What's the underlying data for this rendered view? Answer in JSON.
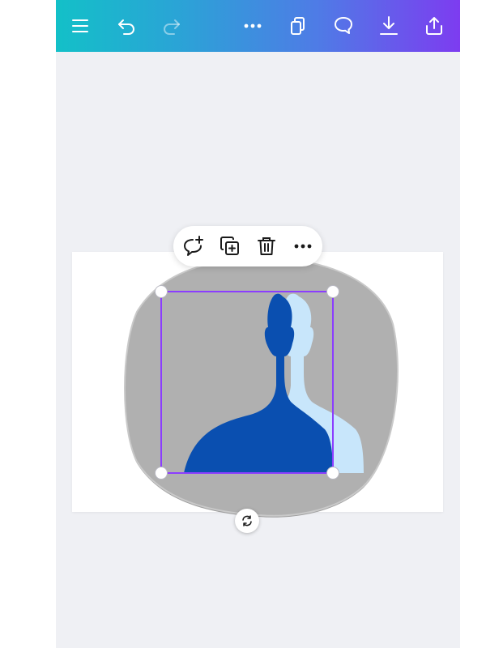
{
  "toolbar": {
    "buttons": [
      {
        "icon": "menu-icon"
      },
      {
        "icon": "undo-icon"
      },
      {
        "icon": "redo-icon",
        "disabled": true
      },
      {
        "icon": "more-icon"
      },
      {
        "icon": "pages-icon"
      },
      {
        "icon": "comment-icon"
      },
      {
        "icon": "download-icon"
      },
      {
        "icon": "share-icon"
      }
    ],
    "gradient": [
      "#13c0c8",
      "#4f7be6",
      "#7d3cf0"
    ]
  },
  "floating_toolbar": {
    "buttons": [
      {
        "icon": "add-comment-icon"
      },
      {
        "icon": "duplicate-icon"
      },
      {
        "icon": "delete-icon"
      },
      {
        "icon": "more-options-icon"
      }
    ]
  },
  "selection": {
    "color": "#8b3dff",
    "handles": [
      "top-left",
      "top-right",
      "bottom-left",
      "bottom-right"
    ]
  },
  "design": {
    "blob_color": "#b0b0b0",
    "silhouette_color": "#0a4fb0",
    "silhouette_shadow_color": "#c8e6fb"
  },
  "colors": {
    "editor_background": "#eff0f4",
    "page_background": "#ffffff"
  }
}
